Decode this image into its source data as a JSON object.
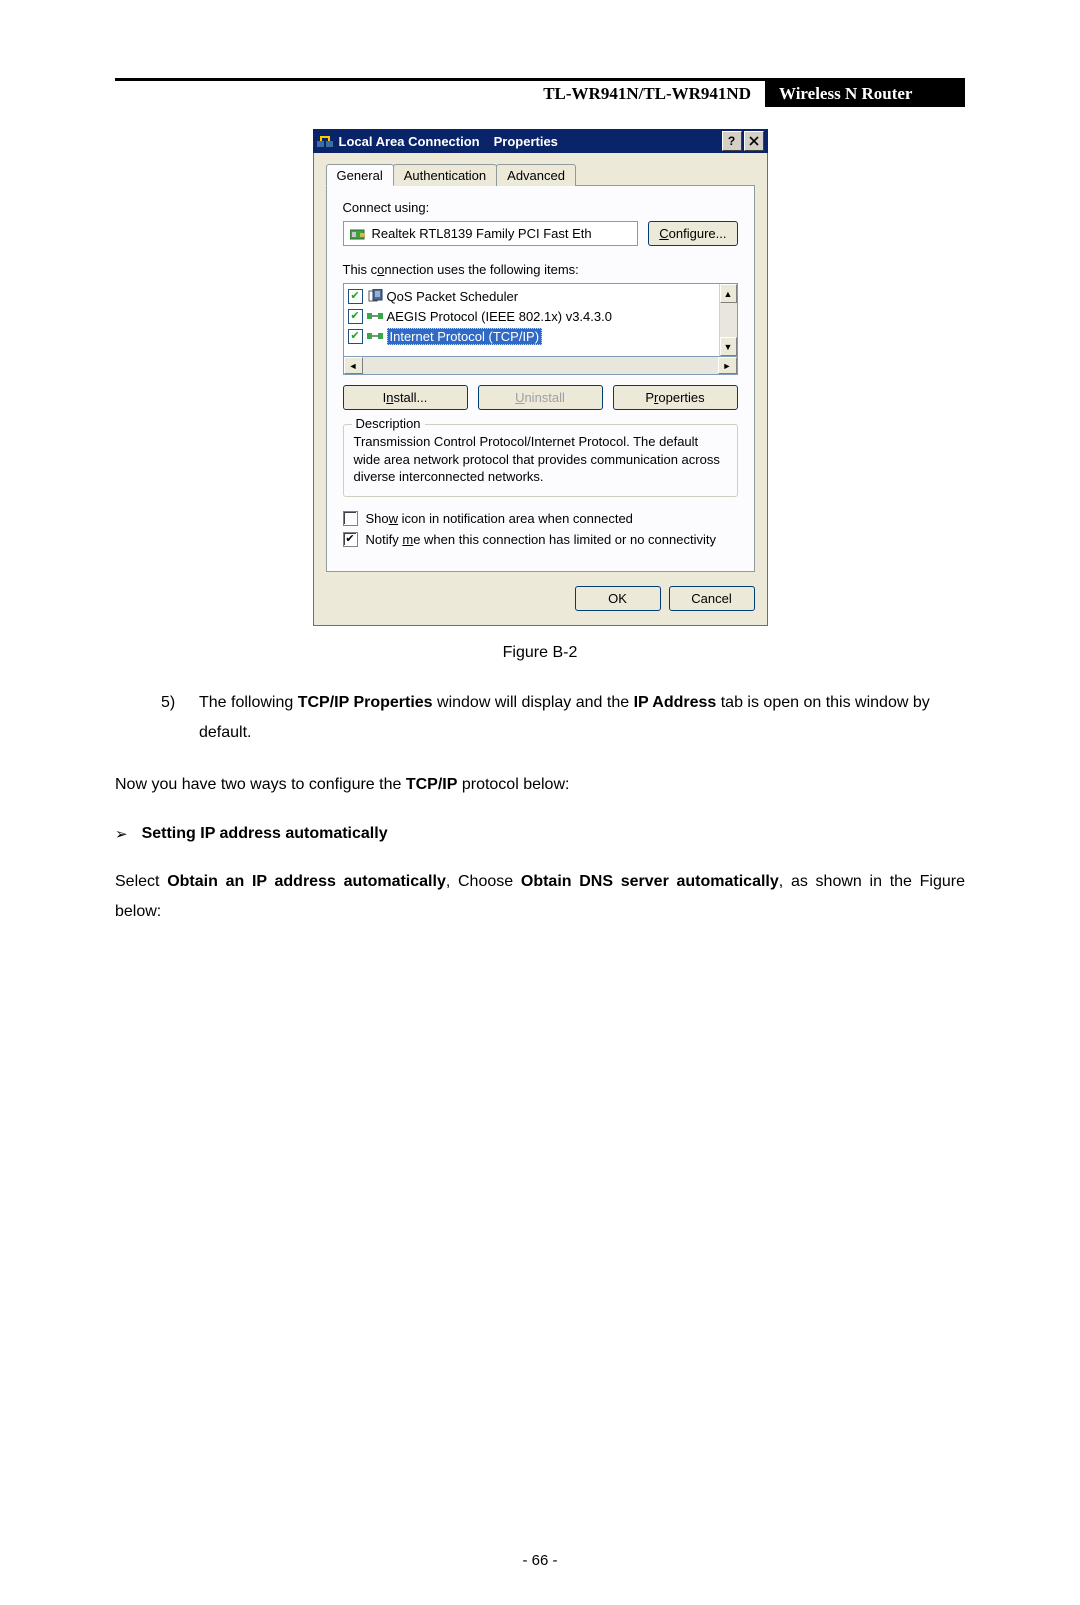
{
  "header": {
    "model": "TL-WR941N/TL-WR941ND",
    "desc": "Wireless  N  Router"
  },
  "dialog": {
    "title": "Local Area Connection",
    "title2": "Properties",
    "tabs": [
      "General",
      "Authentication",
      "Advanced"
    ],
    "connect_using": "Connect using:",
    "adapter": "Realtek RTL8139 Family PCI Fast Eth",
    "configure": "Configure...",
    "configure_u": "C",
    "items_label_pre": "This c",
    "items_label_u": "o",
    "items_label_post": "nnection uses the following items:",
    "items": [
      {
        "label": "QoS Packet Scheduler",
        "checked": true,
        "selected": false,
        "icon": "service"
      },
      {
        "label": "AEGIS Protocol (IEEE 802.1x) v3.4.3.0",
        "checked": true,
        "selected": false,
        "icon": "protocol"
      },
      {
        "label": "Internet Protocol (TCP/IP)",
        "checked": true,
        "selected": true,
        "icon": "protocol"
      }
    ],
    "install": "Install...",
    "install_u": "n",
    "uninstall": "Uninstall",
    "uninstall_u": "U",
    "properties": "Properties",
    "properties_u": "r",
    "desc_legend": "Description",
    "desc_text": "Transmission Control Protocol/Internet Protocol. The default wide area network protocol that provides communication across diverse interconnected networks.",
    "show_icon_pre": "Sho",
    "show_icon_u": "w",
    "show_icon_post": " icon in notification area when connected",
    "show_icon_checked": false,
    "notify_pre": "Notify ",
    "notify_u": "m",
    "notify_post": "e when this connection has limited or no connectivity",
    "notify_checked": true,
    "ok": "OK",
    "cancel": "Cancel"
  },
  "fig_caption": "Figure B-2",
  "step5_num": "5)",
  "step5_a": "The following ",
  "step5_b": "TCP/IP Properties",
  "step5_c": " window will display and the ",
  "step5_d": "IP Address",
  "step5_e": " tab is open on this window by default.",
  "para1_a": "Now you have two ways to configure the ",
  "para1_b": "TCP/IP",
  "para1_c": " protocol below:",
  "bullet1": "Setting IP address automatically",
  "para2_a": "Select ",
  "para2_b": "Obtain an IP address automatically",
  "para2_c": ", Choose ",
  "para2_d": "Obtain DNS server automatically",
  "para2_e": ", as shown in the Figure below:",
  "page_num": "- 66 -"
}
